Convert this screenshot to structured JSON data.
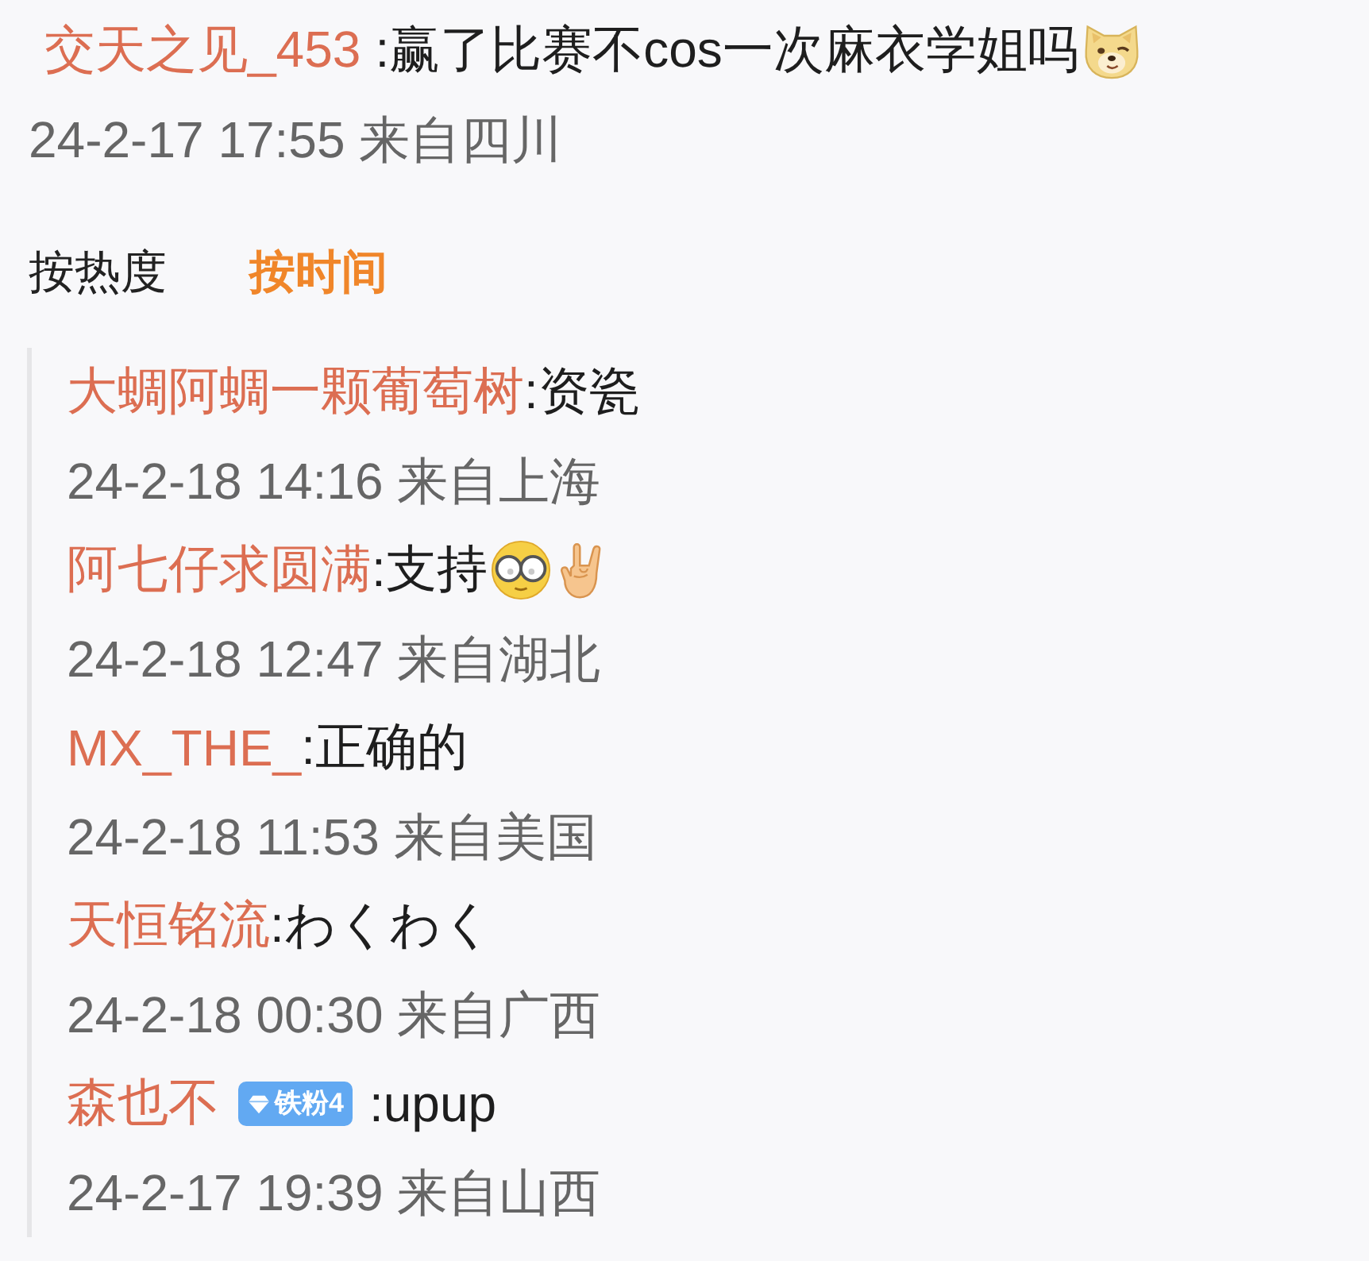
{
  "comment": {
    "user": "交天之见_453",
    "text": ":赢了比赛不cos一次麻衣学姐吗",
    "emojis": [
      {
        "kind": "dog-face"
      }
    ],
    "time": "24-2-17 17:55 来自四川"
  },
  "sort_tabs": [
    {
      "label": "按热度",
      "selected": false
    },
    {
      "label": "按时间",
      "selected": true
    }
  ],
  "replies": [
    {
      "user": "大蜩阿蜩一颗葡萄树",
      "text": ":资瓷",
      "time": "24-2-18 14:16 来自上海"
    },
    {
      "user": "阿七仔求圆满",
      "text": ":支持",
      "emojis": [
        {
          "kind": "glasses-face"
        },
        {
          "kind": "rock-hand"
        }
      ],
      "time": "24-2-18 12:47 来自湖北"
    },
    {
      "user": "MX_THE_",
      "text": ":正确的",
      "time": "24-2-18 11:53 来自美国"
    },
    {
      "user": "天恒铭流",
      "text": ":わくわく",
      "time": "24-2-18 00:30 来自广西"
    },
    {
      "user": "森也不",
      "badge": "铁粉4",
      "text": ":upup",
      "time": "24-2-17 19:39 来自山西"
    }
  ]
}
